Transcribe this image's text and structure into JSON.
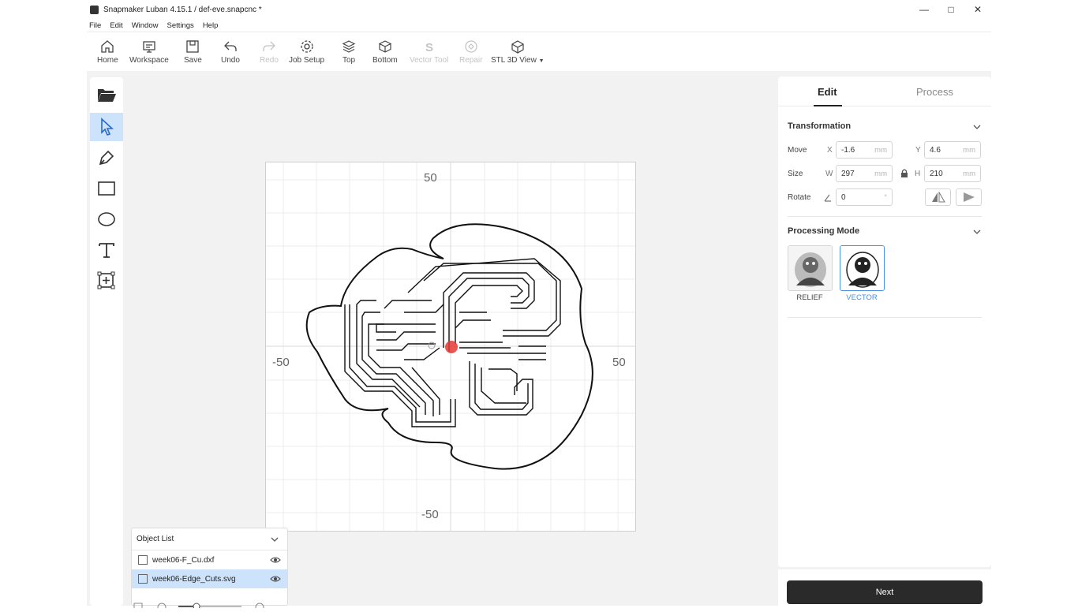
{
  "window": {
    "title": "Snapmaker Luban 4.15.1 / def-eve.snapcnc *"
  },
  "menu": [
    "File",
    "Edit",
    "Window",
    "Settings",
    "Help"
  ],
  "toolbar": {
    "home": "Home",
    "workspace": "Workspace",
    "save": "Save",
    "undo": "Undo",
    "redo": "Redo",
    "job_setup": "Job Setup",
    "top": "Top",
    "bottom": "Bottom",
    "vector_tool": "Vector Tool",
    "repair": "Repair",
    "stl_view": "STL 3D View"
  },
  "canvas": {
    "label_top": "50",
    "label_bottom": "-50",
    "label_left": "-50",
    "label_right": "50"
  },
  "object_list": {
    "title": "Object List",
    "items": [
      {
        "name": "week06-F_Cu.dxf",
        "selected": false
      },
      {
        "name": "week06-Edge_Cuts.svg",
        "selected": true
      }
    ]
  },
  "panel": {
    "tabs": [
      "Edit",
      "Process"
    ],
    "transformation": {
      "title": "Transformation",
      "move_label": "Move",
      "x_label": "X",
      "x_value": "-1.6",
      "y_label": "Y",
      "y_value": "4.6",
      "size_label": "Size",
      "w_label": "W",
      "w_value": "297",
      "h_label": "H",
      "h_value": "210",
      "rotate_label": "Rotate",
      "rotate_value": "0",
      "unit": "mm",
      "deg": "°"
    },
    "processing": {
      "title": "Processing Mode",
      "modes": [
        "RELIEF",
        "VECTOR"
      ],
      "selected": "VECTOR"
    },
    "next": "Next"
  },
  "colors": {
    "accent": "#cde3fb",
    "selected_mode": "#4a8fe0",
    "next_button": "#2a2a2a"
  }
}
